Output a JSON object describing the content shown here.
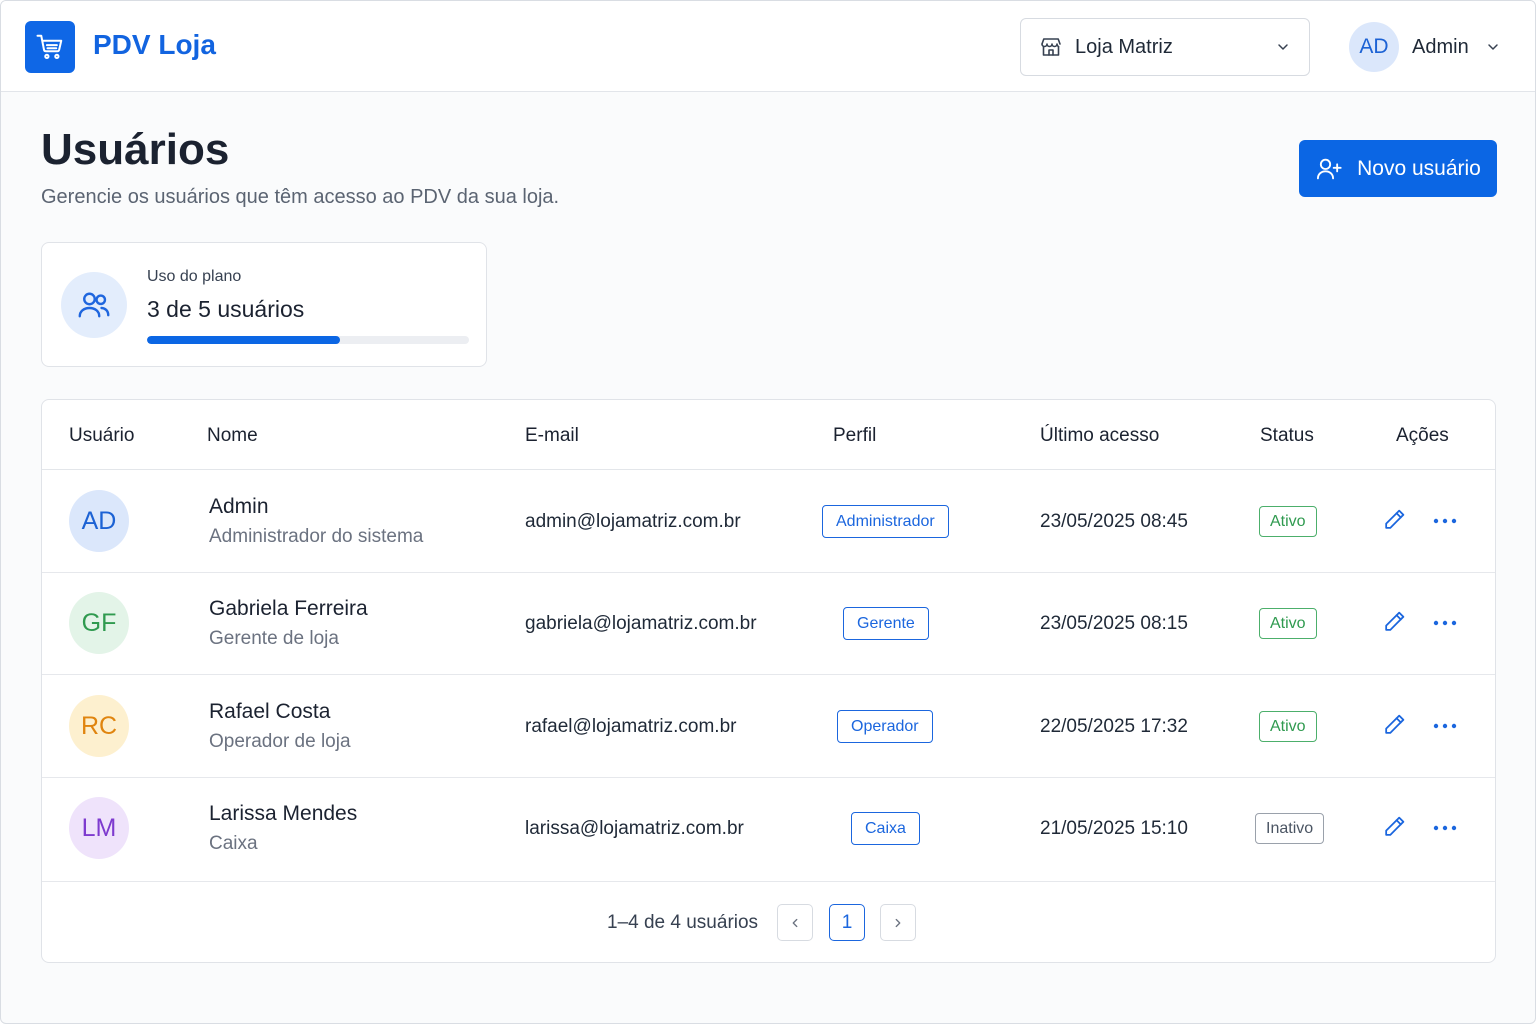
{
  "header": {
    "brand": "PDV Loja",
    "store_select": {
      "value": "Loja Matriz"
    },
    "user": {
      "initials": "AD",
      "name": "Admin"
    }
  },
  "page": {
    "title": "Usuários",
    "subtitle": "Gerencie os usuários que têm acesso ao PDV da sua loja.",
    "new_button": "Novo usuário"
  },
  "plan": {
    "label": "Uso do plano",
    "value": "3 de 5 usuários",
    "used": 3,
    "total": 5
  },
  "table": {
    "columns": [
      "Usuário",
      "Nome",
      "E-mail",
      "Perfil",
      "Último acesso",
      "Status",
      "Ações"
    ],
    "rows": [
      {
        "initials": "AD",
        "name": "Admin",
        "role": "Administrador do sistema",
        "email": "admin@lojamatriz.com.br",
        "profile": "Administrador",
        "last_access": "23/05/2025 08:45",
        "status": "Ativo"
      },
      {
        "initials": "GF",
        "name": "Gabriela Ferreira",
        "role": "Gerente de loja",
        "email": "gabriela@lojamatriz.com.br",
        "profile": "Gerente",
        "last_access": "23/05/2025 08:15",
        "status": "Ativo"
      },
      {
        "initials": "RC",
        "name": "Rafael Costa",
        "role": "Operador de loja",
        "email": "rafael@lojamatriz.com.br",
        "profile": "Operador",
        "last_access": "22/05/2025 17:32",
        "status": "Ativo"
      },
      {
        "initials": "LM",
        "name": "Larissa Mendes",
        "role": "Caixa",
        "email": "larissa@lojamatriz.com.br",
        "profile": "Caixa",
        "last_access": "21/05/2025 15:10",
        "status": "Inativo"
      }
    ]
  },
  "pagination": {
    "info": "1–4 de 4 usuários",
    "current_page": "1"
  },
  "colors": {
    "accent": "#0b66e4",
    "avatar_blue": "#dbe7fb",
    "avatar_green": "#e3f4e8",
    "avatar_orange": "#fdf0cf",
    "avatar_purple": "#efe3fb",
    "status_active": "#2f9a4f",
    "status_inactive": "#4b5563"
  },
  "icons": {
    "logo": "shopping-cart-icon",
    "store": "store-icon",
    "new_user": "user-plus-icon",
    "plan": "users-icon",
    "edit": "pencil-icon",
    "more": "more-horizontal-icon"
  }
}
